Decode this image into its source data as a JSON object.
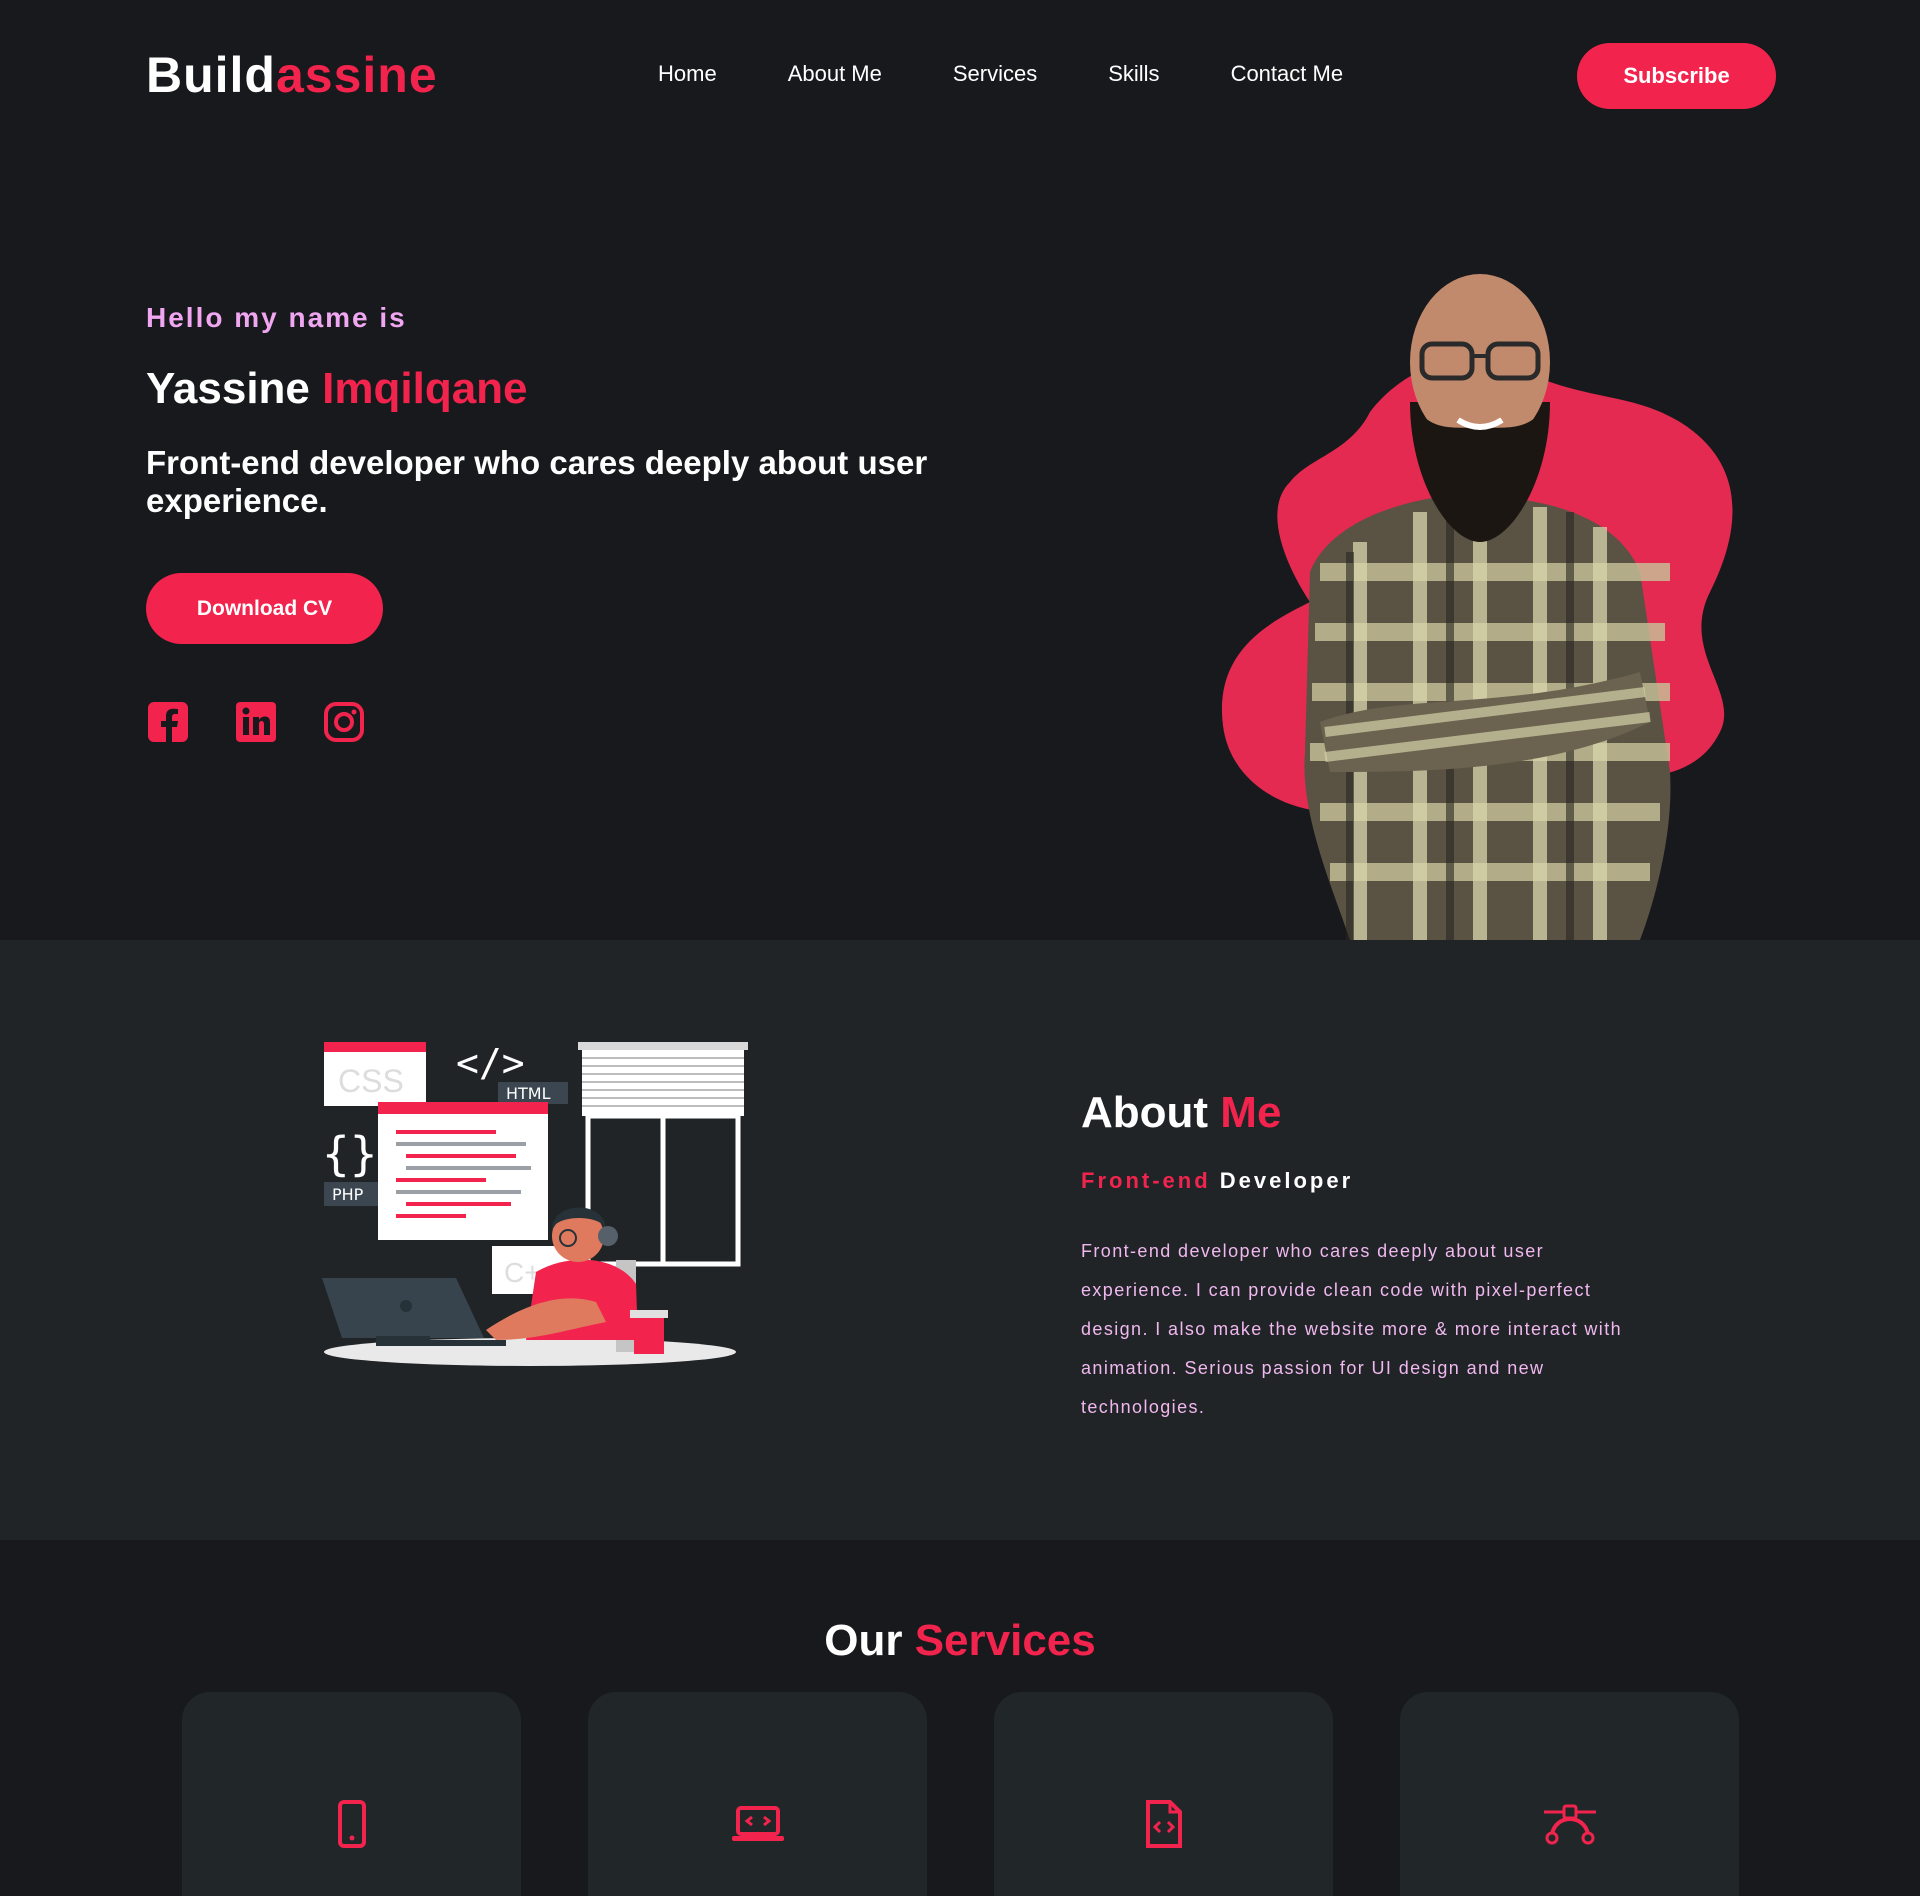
{
  "header": {
    "logo_part1": "Build",
    "logo_part2": "assine",
    "nav": [
      "Home",
      "About Me",
      "Services",
      "Skills",
      "Contact Me"
    ],
    "subscribe_label": "Subscribe"
  },
  "hero": {
    "hello": "Hello my name is",
    "first_name": "Yassine",
    "last_name": "Imqilqane",
    "tagline": "Front-end developer who cares deeply about user experience.",
    "cv_label": "Download CV",
    "socials": [
      "facebook-icon",
      "linkedin-icon",
      "instagram-icon"
    ]
  },
  "illustration_labels": {
    "css": "CSS",
    "html": "HTML",
    "php": "PHP",
    "cpp": "C++"
  },
  "about": {
    "title_part1": "About",
    "title_part2": "Me",
    "sub_part1": "Front-end",
    "sub_part2": "Developer",
    "text": "Front-end developer who cares deeply about user experience. I can provide clean code with pixel-perfect design. I also make the website more & more interact with animation. Serious passion for UI design and new technologies."
  },
  "services": {
    "title_part1": "Our",
    "title_part2": "Services",
    "cards": [
      {
        "icon": "mobile-icon"
      },
      {
        "icon": "laptop-code-icon"
      },
      {
        "icon": "file-code-icon"
      },
      {
        "icon": "bezier-curve-icon"
      }
    ]
  },
  "colors": {
    "accent": "#f2244d",
    "background": "#18191c",
    "section_alt": "#202427",
    "pink_text": "#f0a6f0"
  }
}
